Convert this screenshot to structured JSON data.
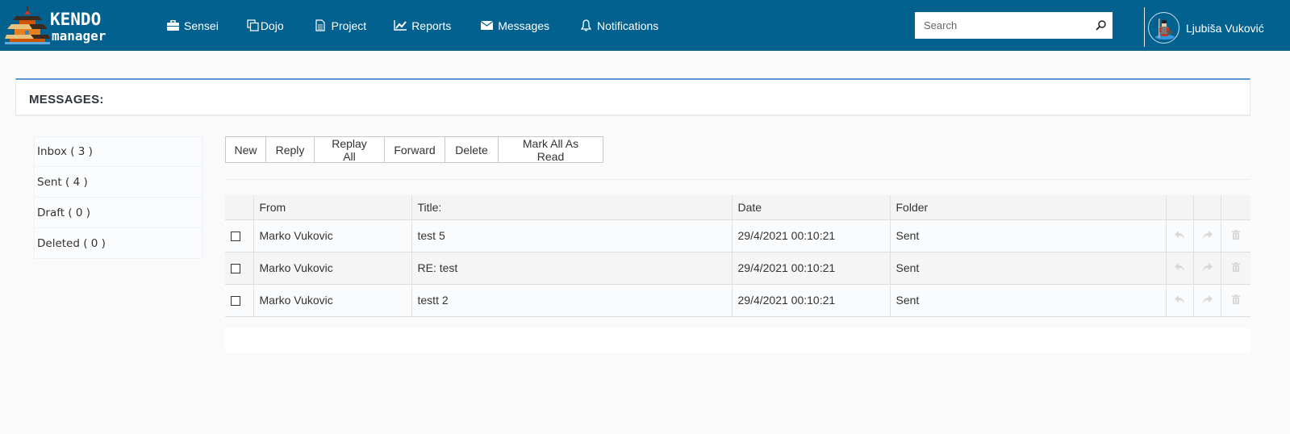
{
  "app": {
    "logo_line1": "KENDO",
    "logo_line2": "manager"
  },
  "nav": {
    "items": [
      {
        "label": "Sensei",
        "icon": "briefcase-icon"
      },
      {
        "label": "Dojo",
        "icon": "copy-icon"
      },
      {
        "label": "Project",
        "icon": "document-icon"
      },
      {
        "label": "Reports",
        "icon": "line-chart-icon"
      },
      {
        "label": "Messages",
        "icon": "envelope-icon"
      },
      {
        "label": "Notifications",
        "icon": "bell-icon"
      }
    ]
  },
  "search": {
    "placeholder": "Search",
    "value": ""
  },
  "user": {
    "name": "Ljubiša Vuković"
  },
  "page": {
    "title": "MESSAGES:"
  },
  "folders": [
    {
      "label": "Inbox ( 3 )",
      "name": "Inbox",
      "count": 3
    },
    {
      "label": "Sent ( 4 )",
      "name": "Sent",
      "count": 4
    },
    {
      "label": "Draft ( 0 )",
      "name": "Draft",
      "count": 0
    },
    {
      "label": "Deleted ( 0 )",
      "name": "Deleted",
      "count": 0
    }
  ],
  "toolbar": {
    "new": "New",
    "reply": "Reply",
    "replay_all": "Replay All",
    "forward": "Forward",
    "delete": "Delete",
    "mark_all_read": "Mark All As Read"
  },
  "table": {
    "columns": [
      "",
      "From",
      "Title:",
      "Date",
      "Folder",
      "",
      "",
      ""
    ],
    "rows": [
      {
        "from": "Marko Vukovic",
        "title": "test 5",
        "date": "29/4/2021 00:10:21",
        "folder": "Sent",
        "checked": false
      },
      {
        "from": "Marko Vukovic",
        "title": "RE: test",
        "date": "29/4/2021 00:10:21",
        "folder": "Sent",
        "checked": false
      },
      {
        "from": "Marko Vukovic",
        "title": "testt 2",
        "date": "29/4/2021 00:10:21",
        "folder": "Sent",
        "checked": false
      }
    ]
  },
  "colors": {
    "navbar": "#02618f",
    "accent": "#5b97d5",
    "action_icon": "#d8d8d8"
  }
}
